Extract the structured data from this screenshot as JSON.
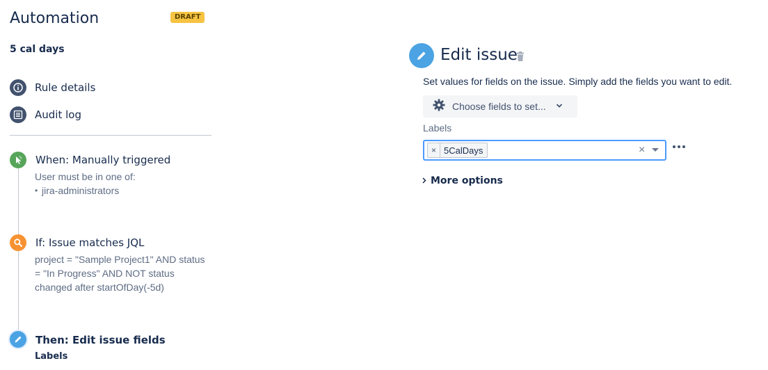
{
  "app": {
    "title": "Automation",
    "badge": "DRAFT"
  },
  "rule": {
    "name": "5 cal days"
  },
  "nav": [
    {
      "label": "Rule details",
      "icon": "info-icon"
    },
    {
      "label": "Audit log",
      "icon": "list-icon"
    }
  ],
  "steps": {
    "trigger": {
      "title": "When: Manually triggered",
      "desc": "User must be in one of:",
      "items": [
        "jira-administrators"
      ],
      "icon": "trigger-icon",
      "color": "#57a55a"
    },
    "condition": {
      "title": "If: Issue matches JQL",
      "desc_lines": [
        "project = \"Sample Project1\" AND status",
        "= \"In Progress\" AND NOT status",
        "changed after startOfDay(-5d)"
      ],
      "icon": "search-icon",
      "color": "#f79232"
    },
    "action": {
      "title": "Then: Edit issue fields",
      "sub": "Labels",
      "icon": "pencil-icon",
      "color": "#4ba3e3"
    }
  },
  "editor": {
    "title": "Edit issue",
    "description": "Set values for fields on the issue. Simply add the fields you want to edit.",
    "choose_fields": "Choose fields to set...",
    "labels_field": "Labels",
    "label_tags": [
      "5CalDays"
    ],
    "more_options": "More options"
  },
  "colors": {
    "accent": "#4c9aff",
    "draft": "#f6c342",
    "trigger": "#57a55a",
    "condition": "#f79232",
    "action": "#4ba3e3"
  }
}
